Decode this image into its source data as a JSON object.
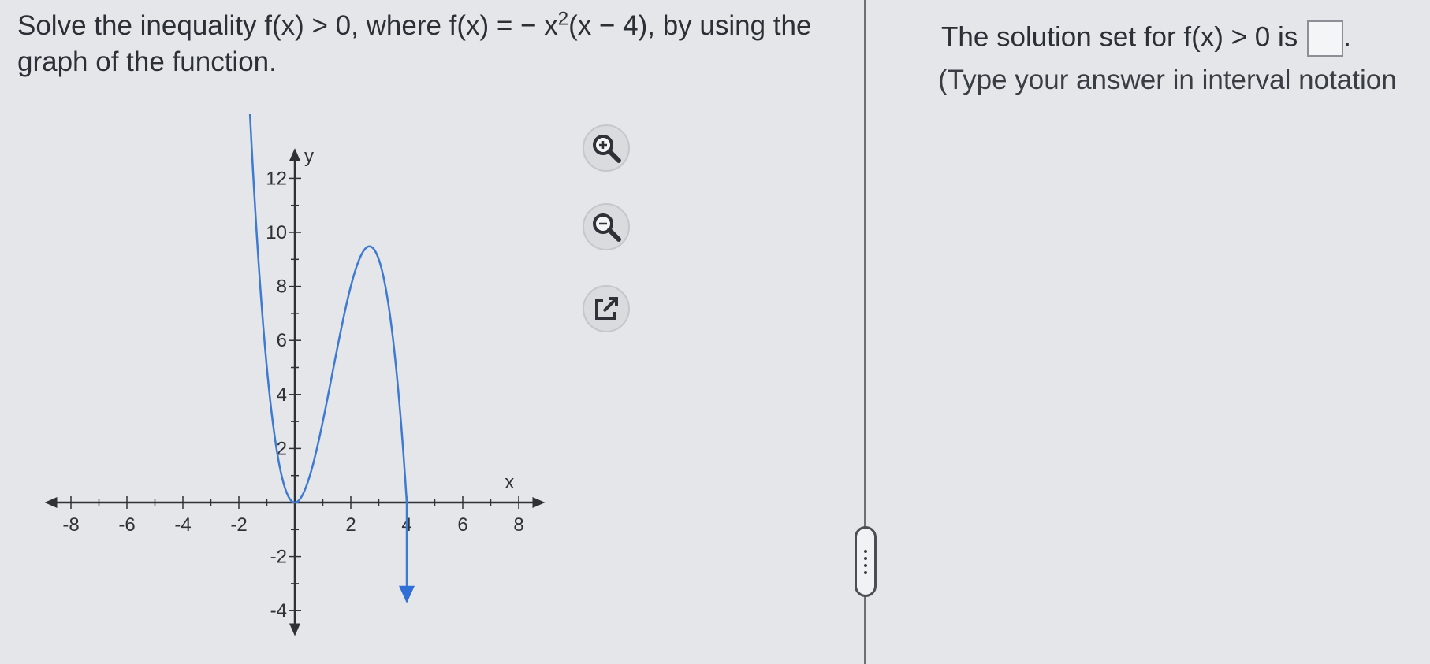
{
  "question": {
    "text_before_sup": "Solve the inequality f(x) > 0, where f(x) = − x",
    "sup": "2",
    "text_after_sup": "(x − 4), by using the graph of the function."
  },
  "graph": {
    "function": "-x^2(x-4)",
    "x_axis_label": "x",
    "y_axis_label": "y",
    "x_ticks": [
      "-8",
      "-6",
      "-4",
      "-2",
      "2",
      "4",
      "6",
      "8"
    ],
    "y_ticks": [
      "12",
      "10",
      "8",
      "6",
      "4",
      "2",
      "-2",
      "-4"
    ],
    "x_range": [
      -9,
      9
    ],
    "y_range": [
      -5,
      13
    ],
    "curve_color": "#3f7ad1",
    "arrow_color": "#2f6fd6"
  },
  "tools": {
    "zoom_in_icon": "zoom-in-icon",
    "zoom_out_icon": "zoom-out-icon",
    "popout_icon": "external-link-icon"
  },
  "answer": {
    "prompt": "The solution set for f(x) > 0 is",
    "input_value": "",
    "period": ".",
    "instruction": "(Type your answer in interval notation"
  }
}
